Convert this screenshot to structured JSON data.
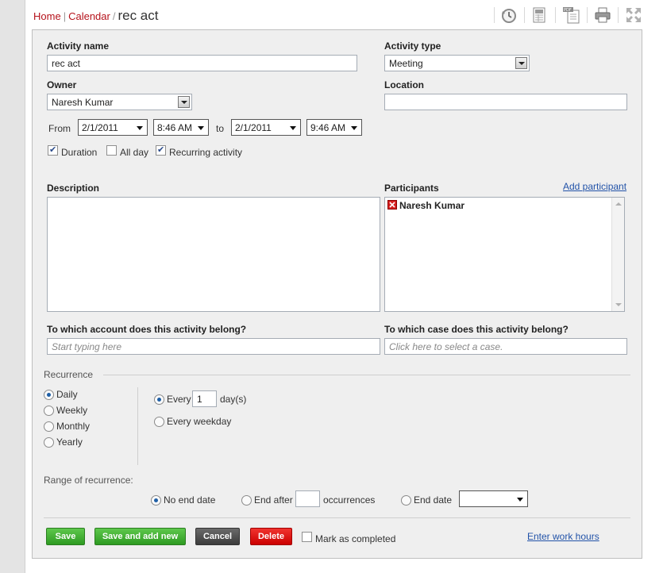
{
  "breadcrumb": {
    "home": "Home",
    "calendar": "Calendar",
    "separator": "|",
    "slash": "/",
    "current": "rec act"
  },
  "toolbar": {
    "icons": [
      "history-icon",
      "excel-export-icon",
      "pdf-export-icon",
      "print-icon",
      "expand-icon"
    ]
  },
  "form": {
    "activity_name_label": "Activity name",
    "activity_name_value": "rec act",
    "activity_type_label": "Activity type",
    "activity_type_value": "Meeting",
    "owner_label": "Owner",
    "owner_value": "Naresh Kumar",
    "location_label": "Location",
    "location_value": "",
    "from_label": "From",
    "from_date": "2/1/2011",
    "from_time": "8:46 AM",
    "to_label": "to",
    "to_date": "2/1/2011",
    "to_time": "9:46 AM",
    "duration_label": "Duration",
    "duration_checked": true,
    "allday_label": "All day",
    "allday_checked": false,
    "recurring_label": "Recurring activity",
    "recurring_checked": true,
    "description_label": "Description",
    "participants_label": "Participants",
    "add_participant": "Add participant",
    "participants": [
      "Naresh Kumar"
    ],
    "account_label": "To which account does this activity belong?",
    "account_placeholder": "Start typing here",
    "case_label": "To which case does this activity belong?",
    "case_placeholder": "Click here to select a case."
  },
  "recurrence": {
    "title": "Recurrence",
    "patterns": [
      {
        "label": "Daily",
        "selected": true
      },
      {
        "label": "Weekly",
        "selected": false
      },
      {
        "label": "Monthly",
        "selected": false
      },
      {
        "label": "Yearly",
        "selected": false
      }
    ],
    "every_label": "Every",
    "every_value": "1",
    "days_label": "day(s)",
    "weekday_label": "Every weekday",
    "range_title": "Range of recurrence:",
    "no_end_label": "No end date",
    "end_after_label": "End after",
    "end_after_value": "",
    "occurrences_label": "occurrences",
    "end_date_label": "End date",
    "end_date_value": ""
  },
  "actions": {
    "save": "Save",
    "save_add_new": "Save and add new",
    "cancel": "Cancel",
    "delete": "Delete",
    "mark_completed": "Mark as completed",
    "work_hours": "Enter work hours"
  },
  "colors": {
    "link_red": "#b5121b",
    "link_blue": "#2152a8",
    "save_green": "#3aa82c",
    "delete_red": "#e10000"
  }
}
